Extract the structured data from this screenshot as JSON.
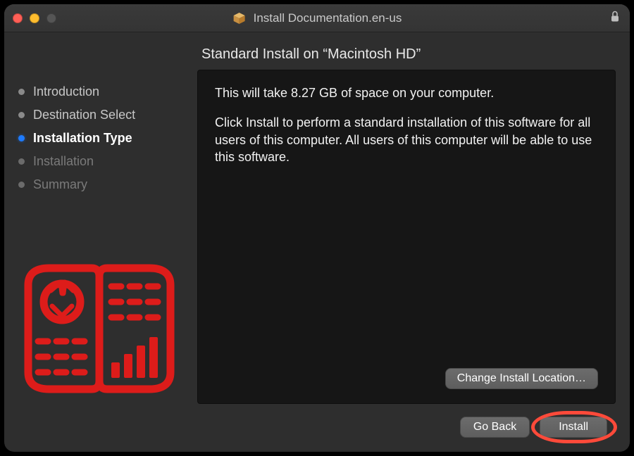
{
  "window": {
    "title": "Install Documentation.en-us"
  },
  "sidebar": {
    "steps": [
      {
        "label": "Introduction",
        "state": "done"
      },
      {
        "label": "Destination Select",
        "state": "done"
      },
      {
        "label": "Installation Type",
        "state": "active"
      },
      {
        "label": "Installation",
        "state": "future"
      },
      {
        "label": "Summary",
        "state": "future"
      }
    ]
  },
  "main": {
    "heading": "Standard Install on “Macintosh HD”",
    "space_line": "This will take 8.27 GB of space on your computer.",
    "description": "Click Install to perform a standard installation of this software for all users of this computer. All users of this computer will be able to use this software.",
    "change_location_label": "Change Install Location…"
  },
  "footer": {
    "go_back": "Go Back",
    "install": "Install"
  },
  "colors": {
    "highlight": "#ff4a3a",
    "accent": "#1e7bff",
    "illustration": "#dd1c1a"
  }
}
